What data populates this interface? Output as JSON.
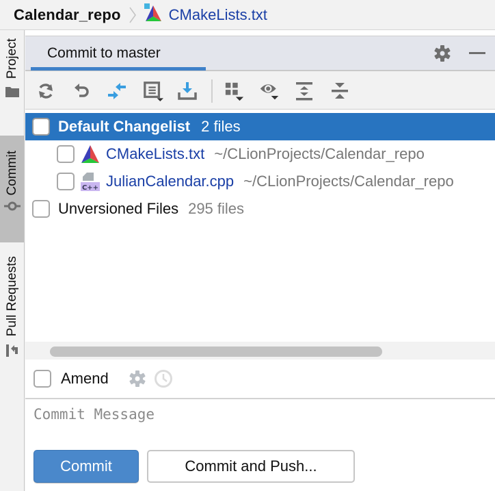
{
  "breadcrumb": {
    "project": "Calendar_repo",
    "file": "CMakeLists.txt",
    "file_icon": "cmake-icon"
  },
  "tool_stripe": {
    "items": [
      {
        "label": "Project",
        "icon": "folder-icon",
        "active": false
      },
      {
        "label": "Commit",
        "icon": "commit-icon",
        "active": true
      },
      {
        "label": "Pull Requests",
        "icon": "pull-request-icon",
        "active": false
      }
    ]
  },
  "panel": {
    "tab_label": "Commit to master",
    "header_icons": [
      "gear-icon",
      "minimize-icon"
    ]
  },
  "toolbar": {
    "buttons": [
      {
        "name": "refresh",
        "icon": "refresh-icon"
      },
      {
        "name": "rollback",
        "icon": "undo-icon"
      },
      {
        "name": "show-diff",
        "icon": "diff-icon"
      },
      {
        "name": "changelist",
        "icon": "changelist-icon",
        "dropdown": true
      },
      {
        "name": "update",
        "icon": "download-icon"
      },
      {
        "name": "group-by",
        "icon": "group-icon",
        "dropdown": true
      },
      {
        "name": "view-options",
        "icon": "eye-icon",
        "dropdown": true
      },
      {
        "name": "expand-all",
        "icon": "expand-all-icon"
      },
      {
        "name": "collapse-all",
        "icon": "collapse-all-icon"
      }
    ]
  },
  "changes": {
    "default_changelist": {
      "title": "Default Changelist",
      "count": "2 files",
      "checked": false,
      "files": [
        {
          "name": "CMakeLists.txt",
          "path": "~/CLionProjects/Calendar_repo",
          "icon": "cmake-icon",
          "checked": false
        },
        {
          "name": "JulianCalendar.cpp",
          "path": "~/CLionProjects/Calendar_repo",
          "icon": "cpp-file-icon",
          "checked": false
        }
      ]
    },
    "unversioned": {
      "title": "Unversioned Files",
      "count": "295 files",
      "checked": false
    }
  },
  "amend": {
    "label": "Amend",
    "checked": false
  },
  "commit_message": {
    "value": "",
    "placeholder": "Commit Message"
  },
  "actions": {
    "commit": "Commit",
    "commit_and_push": "Commit and Push..."
  },
  "colors": {
    "selection": "#2874c0",
    "accent": "#3f81c9",
    "primary_button": "#4a88cb",
    "file_link": "#1a3fa6"
  }
}
